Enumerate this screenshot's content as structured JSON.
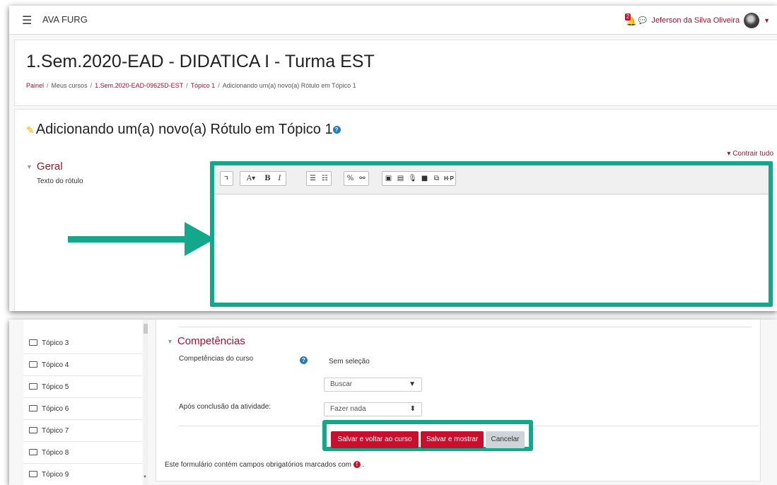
{
  "navbar": {
    "site_name": "AVA FURG",
    "notification_count": "2",
    "user_name": "Jeferson da Silva Oliveira"
  },
  "header": {
    "course_title": "1.Sem.2020-EAD - DIDATICA I - Turma EST",
    "breadcrumb": [
      "Painel",
      "Meus cursos",
      "1.Sem.2020-EAD-09625D-EST",
      "Tópico 1",
      "Adicionando um(a) novo(a) Rótulo em Tópico 1"
    ]
  },
  "form": {
    "title": "Adicionando um(a) novo(a) Rótulo em Tópico 1",
    "collapse_all": "Contrair tudo",
    "section_general": "Geral",
    "label_text_field": "Texto do rótulo",
    "toolbar": {
      "expand": "↴",
      "font": "A▾",
      "bold": "B",
      "italic": "I",
      "h5p": "H·P"
    }
  },
  "sidebar": {
    "items": [
      "Tópico 3",
      "Tópico 4",
      "Tópico 5",
      "Tópico 6",
      "Tópico 7",
      "Tópico 8",
      "Tópico 9"
    ]
  },
  "competencies": {
    "section_title": "Competências",
    "course_competencies_label": "Competências do curso",
    "no_selection": "Sem seleção",
    "search_placeholder": "Buscar",
    "after_completion_label": "Após conclusão da atividade:",
    "after_completion_value": "Fazer nada"
  },
  "buttons": {
    "save_return": "Salvar e voltar ao curso",
    "save_display": "Salvar e mostrar",
    "cancel": "Cancelar"
  },
  "required_note": "Este formulário contém campos obrigatórios marcados com",
  "colors": {
    "accent": "#13a88c",
    "brand": "#c8102e"
  }
}
